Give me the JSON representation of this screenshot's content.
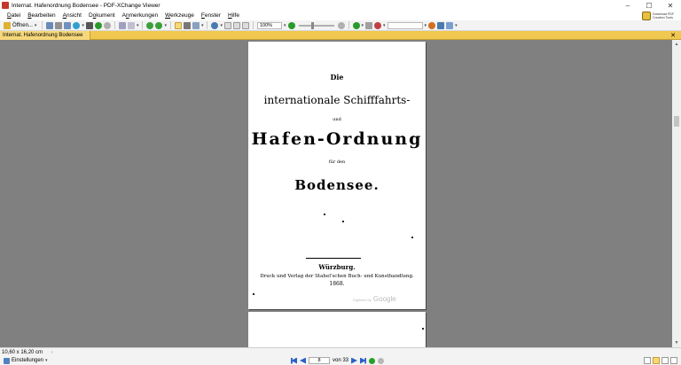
{
  "window": {
    "title": "Internat. Hafenordnung Bodensee - PDF-XChange Viewer",
    "controls": {
      "minimize": "–",
      "maximize": "☐",
      "close": "✕"
    }
  },
  "menu": {
    "items": [
      {
        "pre": "",
        "key": "D",
        "post": "atei"
      },
      {
        "pre": "",
        "key": "B",
        "post": "earbeiten"
      },
      {
        "pre": "",
        "key": "A",
        "post": "nsicht"
      },
      {
        "pre": "D",
        "key": "o",
        "post": "kument"
      },
      {
        "pre": "A",
        "key": "n",
        "post": "merkungen"
      },
      {
        "pre": "",
        "key": "W",
        "post": "erkzeuge"
      },
      {
        "pre": "",
        "key": "F",
        "post": "enster"
      },
      {
        "pre": "",
        "key": "H",
        "post": "ilfe"
      }
    ],
    "download_badge": "Download PDF Creation Tools"
  },
  "toolbar": {
    "open_label": "Öffnen...",
    "zoom_value": "100%",
    "search_value": ""
  },
  "tabs": {
    "active": "Internat. Hafenordnung Bodensee",
    "close": "✕"
  },
  "document": {
    "page1": {
      "die": "Die",
      "title_line": "internationale Schifffahrts-",
      "und": "und",
      "hafen": "Hafen-Ordnung",
      "fuer": "für den",
      "bodensee": "Bodensee.",
      "city": "Würzburg.",
      "printer": "Druck und Verlag der Stahel'schen Buch- und Kunsthandlung.",
      "year": "1868.",
      "watermark_small": "Digitized by",
      "watermark": "Google"
    }
  },
  "status": {
    "dimensions": "10,60 x 16,20 cm",
    "scroll_arrow": "‹"
  },
  "bottom": {
    "settings_label": "Einstellungen",
    "current_page": "8",
    "of_label": "von 33"
  },
  "colors": {
    "accent_tab": "#f6d87a",
    "tabbar": "#f0c850",
    "viewport_bg": "#808080",
    "nav_blue": "#2a62c8",
    "nav_green": "#28a028"
  }
}
